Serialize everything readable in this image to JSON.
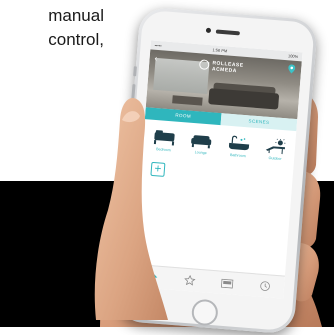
{
  "caption": {
    "line1": "manual",
    "line2": "control,"
  },
  "phone": {
    "status_bar": {
      "carrier": "•••••",
      "time": "1:56 PM",
      "battery": "100%"
    },
    "app": {
      "brand_line1": "ROLLEASE",
      "brand_line2": "ACMEDA",
      "tabs": [
        {
          "label": "ROOM",
          "active": true
        },
        {
          "label": "SCENES",
          "active": false
        }
      ],
      "rooms": [
        {
          "label": "Bedroom",
          "icon": "bed-icon"
        },
        {
          "label": "Lounge",
          "icon": "sofa-icon"
        },
        {
          "label": "Bathroom",
          "icon": "bath-icon"
        },
        {
          "label": "Outdoor",
          "icon": "sun-lounger-icon"
        }
      ],
      "add_label": "+",
      "bottom_nav": [
        {
          "icon": "home-icon",
          "active": true
        },
        {
          "icon": "star-icon",
          "active": false
        },
        {
          "icon": "window-icon",
          "active": false
        },
        {
          "icon": "clock-icon",
          "active": false
        }
      ],
      "accent_color": "#2fb6bd"
    }
  }
}
